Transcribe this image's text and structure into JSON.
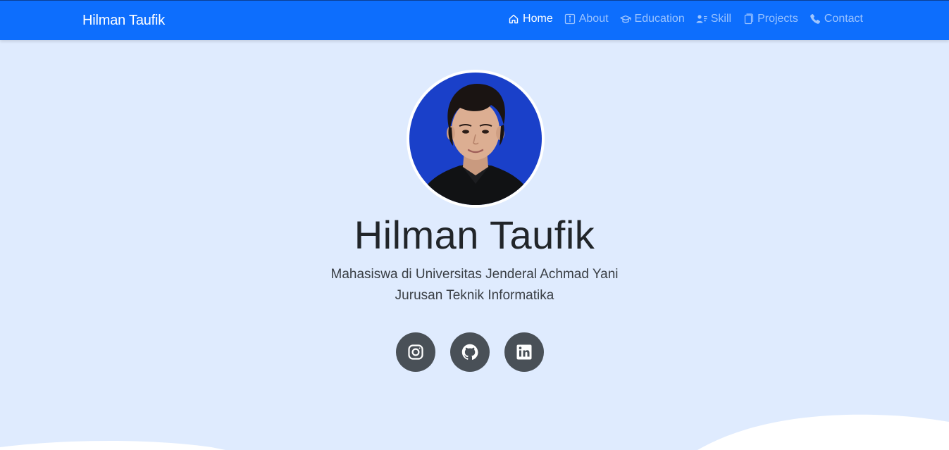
{
  "navbar": {
    "brand": "Hilman Taufik",
    "items": [
      {
        "label": "Home",
        "icon": "house-icon",
        "active": true
      },
      {
        "label": "About",
        "icon": "info-square-icon",
        "active": false
      },
      {
        "label": "Education",
        "icon": "mortarboard-icon",
        "active": false
      },
      {
        "label": "Skill",
        "icon": "person-lines-icon",
        "active": false
      },
      {
        "label": "Projects",
        "icon": "files-icon",
        "active": false
      },
      {
        "label": "Contact",
        "icon": "telephone-icon",
        "active": false
      }
    ]
  },
  "hero": {
    "name": "Hilman Taufik",
    "subtitle_line1": "Mahasiswa di Universitas Jenderal Achmad Yani",
    "subtitle_line2": "Jurusan Teknik Informatika",
    "avatar_icon": "profile-photo",
    "socials": [
      {
        "icon": "instagram-icon"
      },
      {
        "icon": "github-icon"
      },
      {
        "icon": "linkedin-icon"
      }
    ]
  },
  "colors": {
    "navbar": "#0d6efd",
    "page_background": "#dfebfe",
    "social_button": "#495057",
    "wave": "#ffffff",
    "photo_background": "#1a40c9"
  }
}
